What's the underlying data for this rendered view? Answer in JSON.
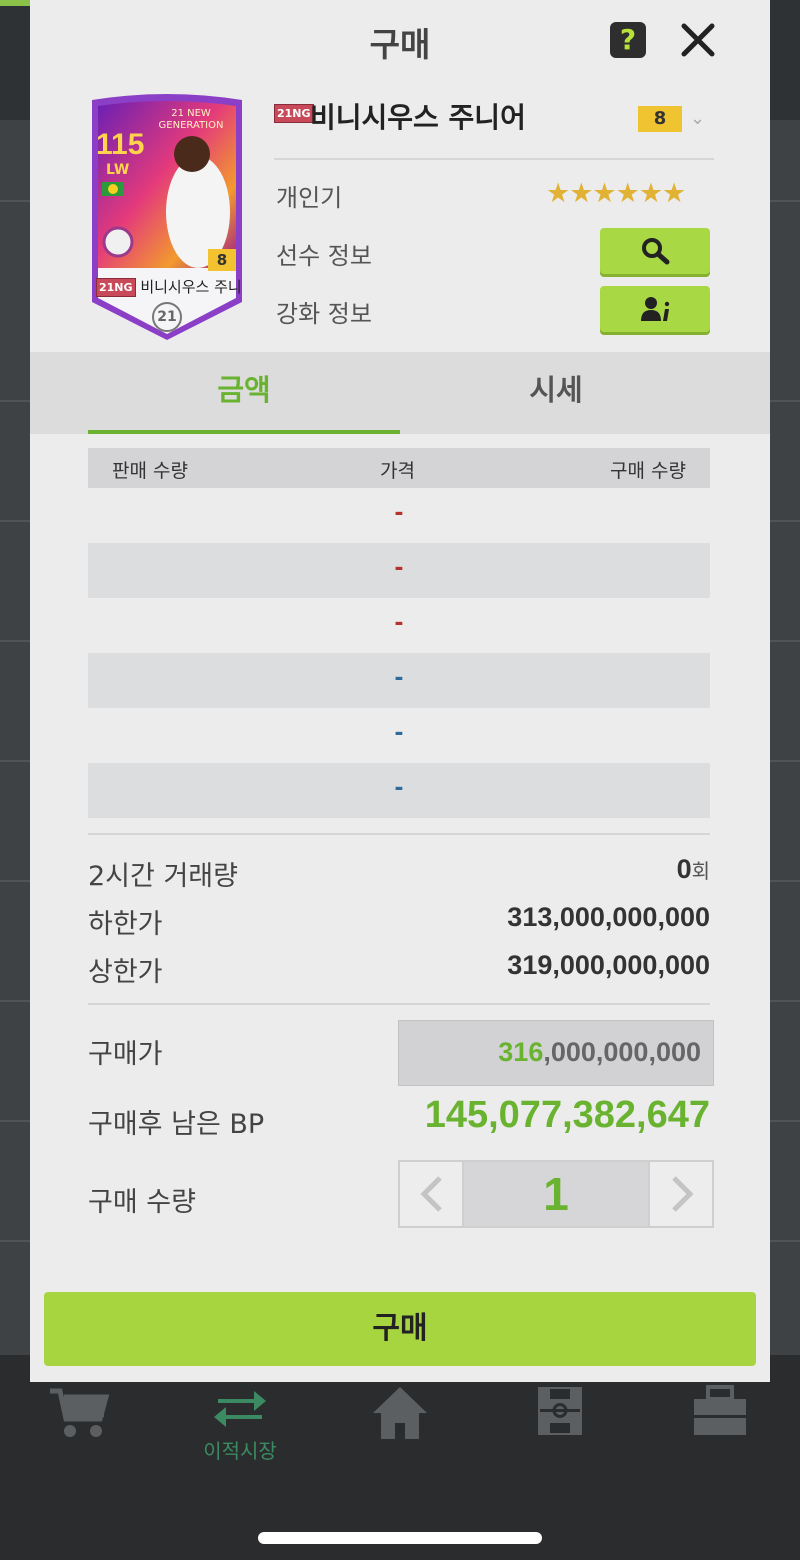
{
  "modal": {
    "title": "구매",
    "help_label": "?"
  },
  "card": {
    "ovr": "115",
    "position": "LW",
    "generation": "21 NEW GENERATION",
    "level": "8",
    "name": "비니시우스 주니(",
    "season": "21",
    "badge": "21NG"
  },
  "player": {
    "badge": "21NG",
    "name": "비니시우스 주니어",
    "level": "8",
    "popularity_label": "개인기",
    "popularity_stars": "★★★★★★",
    "info_label": "선수 정보",
    "upgrade_label": "강화 정보"
  },
  "tabs": [
    {
      "label": "금액"
    },
    {
      "label": "시세"
    }
  ],
  "table": {
    "headers": [
      "판매 수량",
      "가격",
      "구매 수량"
    ],
    "rows": [
      {
        "price": "-",
        "color": "red"
      },
      {
        "price": "-",
        "color": "red"
      },
      {
        "price": "-",
        "color": "red"
      },
      {
        "price": "-",
        "color": "blue"
      },
      {
        "price": "-",
        "color": "blue"
      },
      {
        "price": "-",
        "color": "blue"
      }
    ]
  },
  "stats": {
    "volume_label": "2시간 거래량",
    "volume_value": "0",
    "volume_unit": "회",
    "min_label": "하한가",
    "min_value": "313,000,000,000",
    "max_label": "상한가",
    "max_value": "319,000,000,000"
  },
  "purchase": {
    "price_label": "구매가",
    "price_highlight": "316",
    "price_rest": ",000,000,000",
    "remaining_label": "구매후 남은 BP",
    "remaining_value": "145,077,382,647",
    "quantity_label": "구매 수량",
    "quantity_value": "1",
    "buy_label": "구매"
  },
  "bottom_nav": {
    "items": [
      {
        "icon": "cart-icon",
        "label": ""
      },
      {
        "icon": "transfer-icon",
        "label": "이적시장"
      },
      {
        "icon": "home-icon",
        "label": ""
      },
      {
        "icon": "field-icon",
        "label": ""
      },
      {
        "icon": "briefcase-icon",
        "label": ""
      }
    ]
  },
  "colors": {
    "accent": "#a6d540",
    "tab_active": "#6ab330",
    "stars": "#e1b235",
    "sell_dash": "#b4322a",
    "buy_dash": "#2f6b9a"
  }
}
